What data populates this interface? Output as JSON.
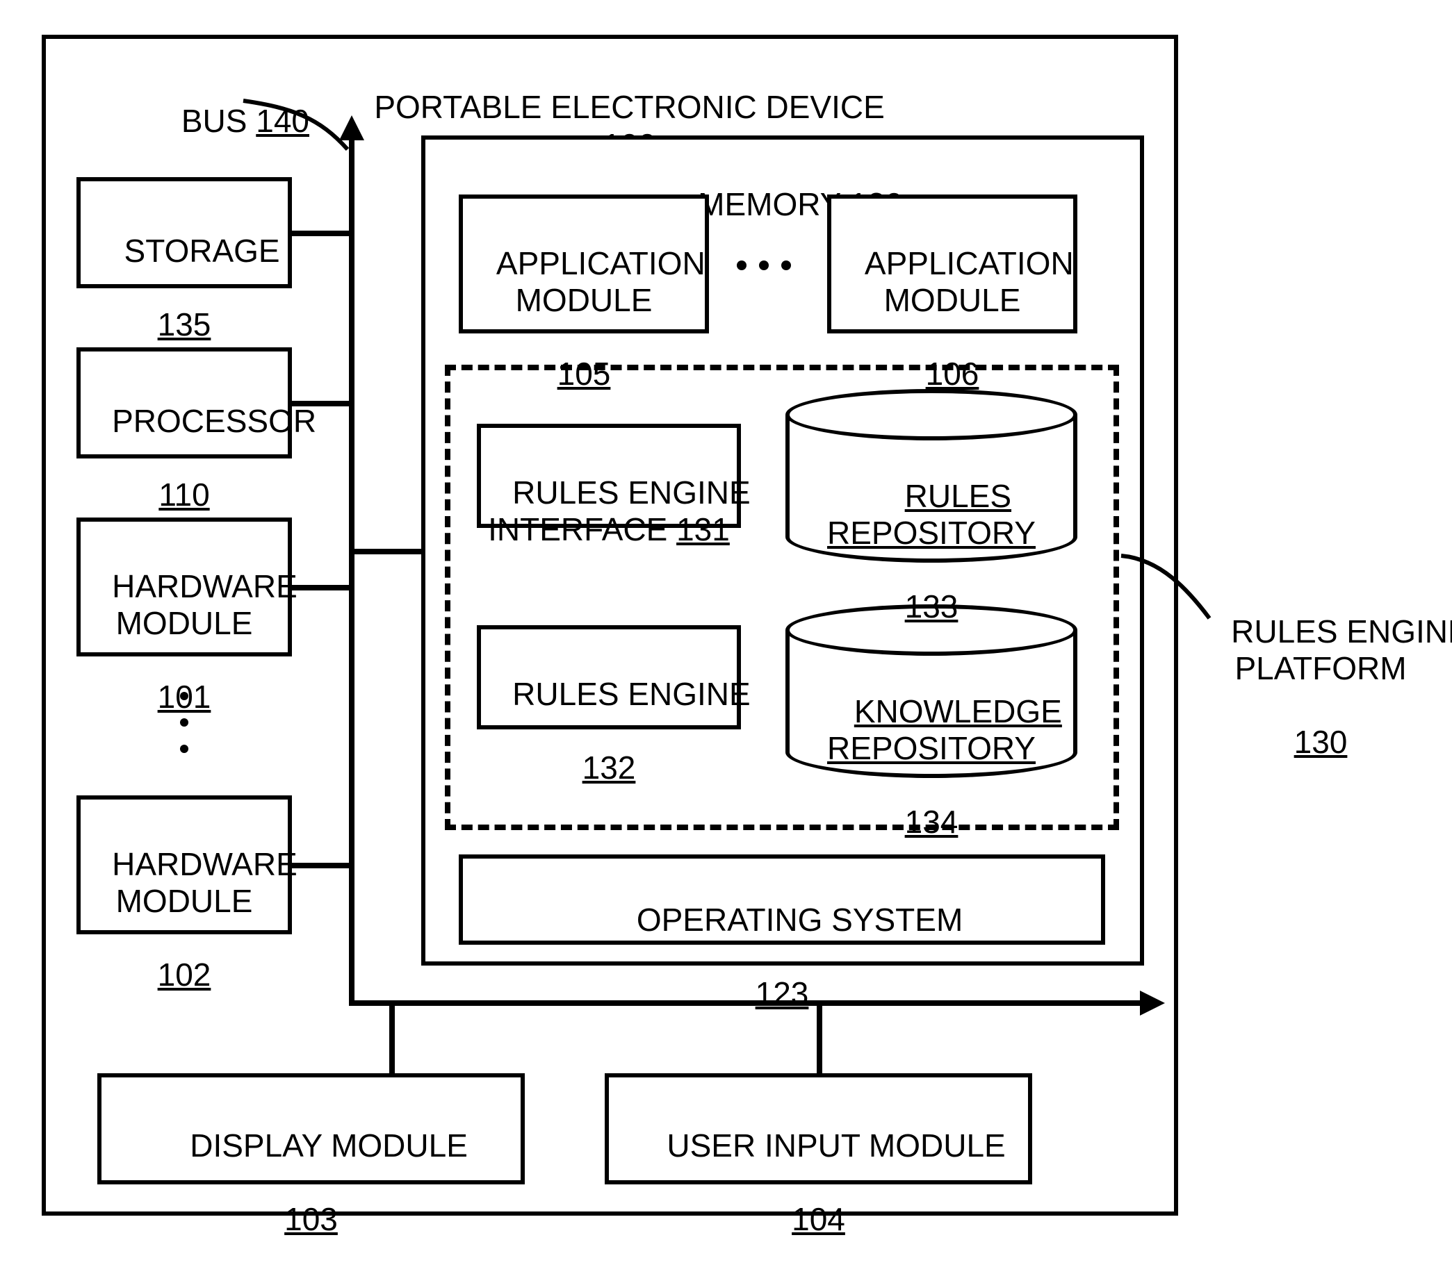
{
  "device": {
    "title": "PORTABLE ELECTRONIC DEVICE",
    "ref": "100"
  },
  "bus": {
    "title": "BUS",
    "ref": "140"
  },
  "left": {
    "storage": {
      "title": "STORAGE",
      "ref": "135"
    },
    "processor": {
      "title": "PROCESSOR",
      "ref": "110"
    },
    "hw1": {
      "title": "HARDWARE\nMODULE",
      "ref": "101"
    },
    "hw2": {
      "title": "HARDWARE\nMODULE",
      "ref": "102"
    }
  },
  "bottom": {
    "display": {
      "title": "DISPLAY MODULE",
      "ref": "103"
    },
    "userinput": {
      "title": "USER INPUT MODULE",
      "ref": "104"
    }
  },
  "memory": {
    "title": "MEMORY",
    "ref": "120",
    "app1": {
      "title": "APPLICATION\nMODULE",
      "ref": "105"
    },
    "app2": {
      "title": "APPLICATION\nMODULE",
      "ref": "106"
    },
    "os": {
      "title": "OPERATING SYSTEM",
      "ref": "123"
    }
  },
  "platform": {
    "title": "RULES ENGINE\nPLATFORM",
    "ref": "130",
    "rei": {
      "title": "RULES ENGINE\nINTERFACE",
      "ref": "131"
    },
    "re": {
      "title": "RULES ENGINE",
      "ref": "132"
    },
    "rules": {
      "title": "RULES\nREPOSITORY",
      "ref": "133"
    },
    "know": {
      "title": "KNOWLEDGE\nREPOSITORY",
      "ref": "134"
    }
  }
}
